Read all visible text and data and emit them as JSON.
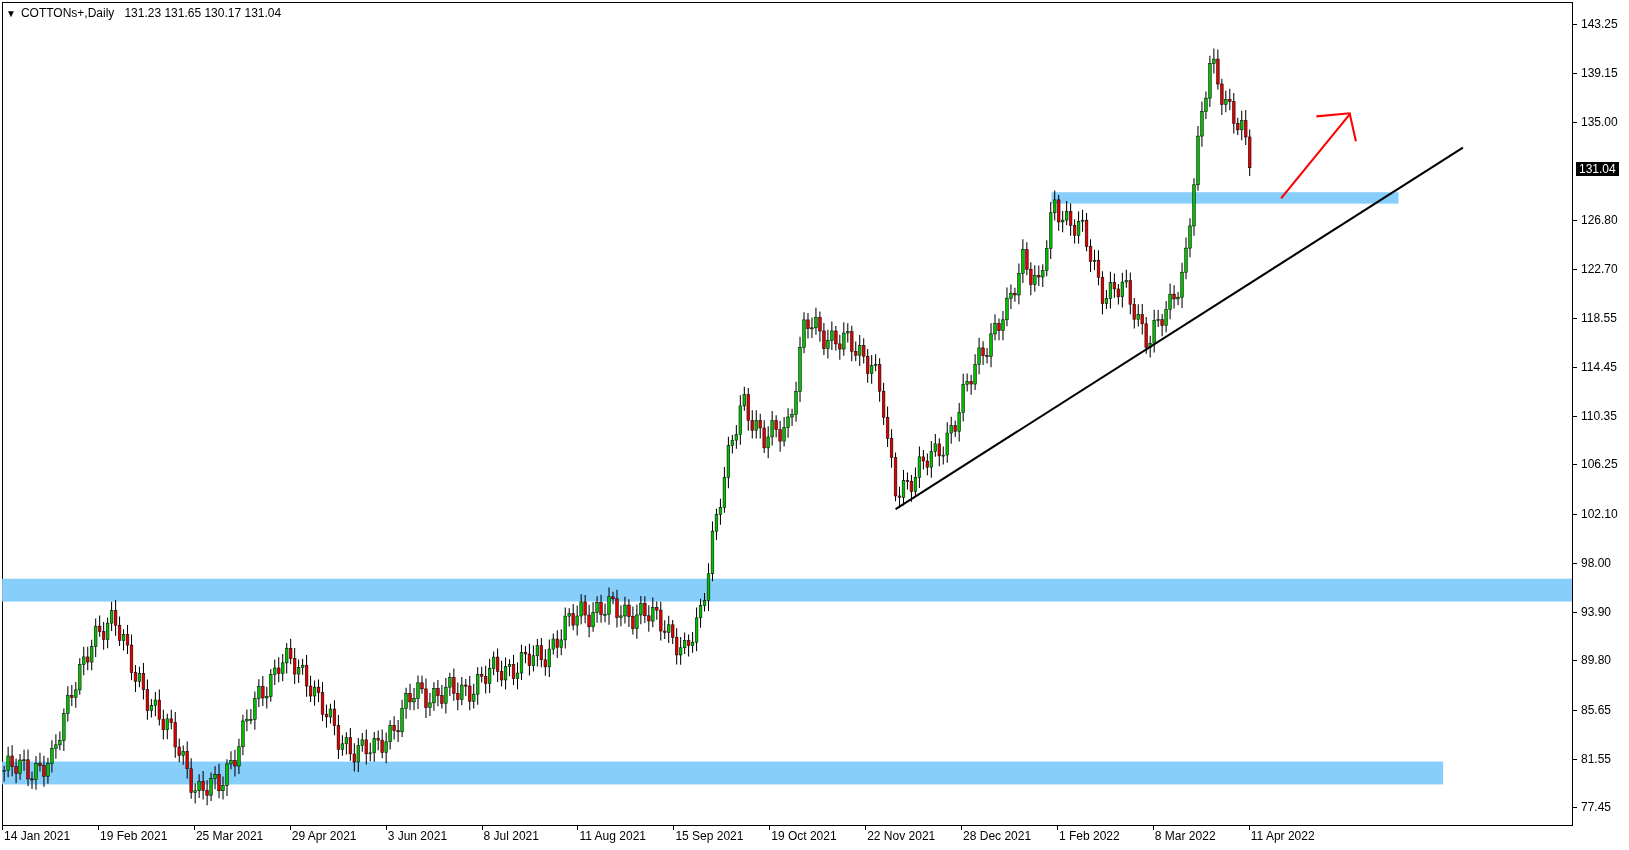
{
  "chart_header": {
    "menu_icon": "▼",
    "symbol": "COTTONs+,Daily",
    "ohlc": "131.23 131.65 130.17 131.04"
  },
  "price_axis": {
    "labels": [
      "143.25",
      "139.15",
      "135.00",
      "126.80",
      "122.70",
      "118.55",
      "114.45",
      "110.35",
      "106.25",
      "102.10",
      "98.00",
      "93.90",
      "89.80",
      "85.65",
      "81.55",
      "77.45"
    ],
    "current_price": "131.04"
  },
  "time_axis": {
    "labels": [
      "14 Jan 2021",
      "19 Feb 2021",
      "25 Mar 2021",
      "29 Apr 2021",
      "3 Jun 2021",
      "8 Jul 2021",
      "11 Aug 2021",
      "15 Sep 2021",
      "19 Oct 2021",
      "22 Nov 2021",
      "28 Dec 2021",
      "1 Feb 2022",
      "8 Mar 2022",
      "11 Apr 2022"
    ]
  }
}
